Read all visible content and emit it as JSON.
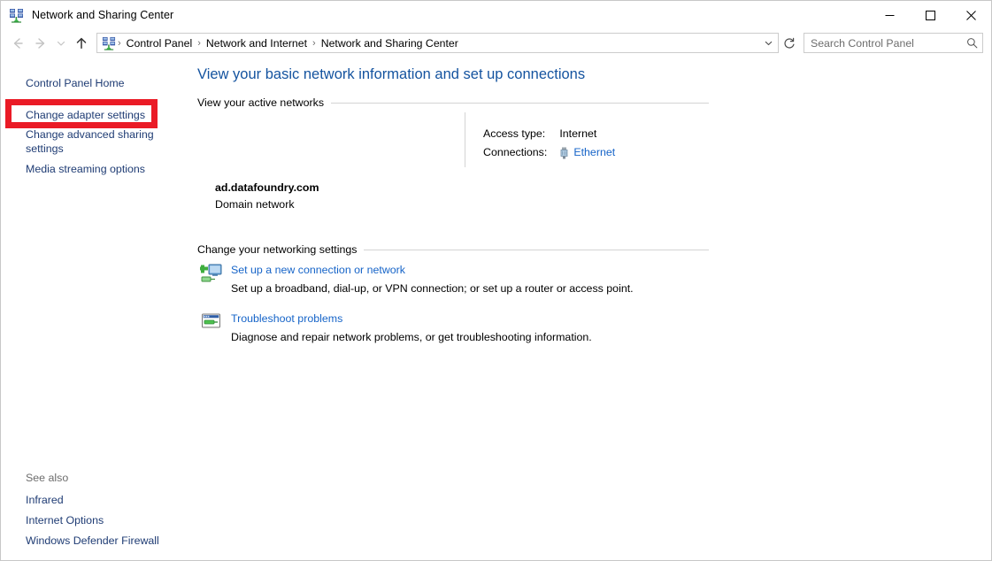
{
  "window": {
    "title": "Network and Sharing Center",
    "icon": "network-sharing-center-icon",
    "minimize_label": "Minimize",
    "maximize_label": "Maximize",
    "close_label": "Close"
  },
  "addressbar": {
    "back_label": "Back",
    "forward_label": "Forward",
    "recent_label": "Recent locations",
    "up_label": "Up one level",
    "breadcrumbs": [
      "Control Panel",
      "Network and Internet",
      "Network and Sharing Center"
    ],
    "separator": "›",
    "dropdown_label": "Previous locations",
    "refresh_label": "Refresh"
  },
  "search": {
    "placeholder": "Search Control Panel",
    "icon": "search-icon"
  },
  "sidebar": {
    "control_panel_home": "Control Panel Home",
    "items": [
      {
        "label": "Change adapter settings",
        "highlighted": true
      },
      {
        "label": "Change advanced sharing settings",
        "highlighted": false
      },
      {
        "label": "Media streaming options",
        "highlighted": false
      }
    ],
    "see_also_heading": "See also",
    "see_also": [
      "Infrared",
      "Internet Options",
      "Windows Defender Firewall"
    ]
  },
  "main": {
    "heading": "View your basic network information and set up connections",
    "active_networks_section": "View your active networks",
    "network": {
      "name": "ad.datafoundry.com",
      "type": "Domain network",
      "access_type_label": "Access type:",
      "access_type_value": "Internet",
      "connections_label": "Connections:",
      "connections_value": "Ethernet",
      "connections_icon": "ethernet-adapter-icon"
    },
    "change_settings_section": "Change your networking settings",
    "tasks": [
      {
        "icon": "new-connection-icon",
        "title": "Set up a new connection or network",
        "description": "Set up a broadband, dial-up, or VPN connection; or set up a router or access point."
      },
      {
        "icon": "troubleshoot-icon",
        "title": "Troubleshoot problems",
        "description": "Diagnose and repair network problems, or get troubleshooting information."
      }
    ]
  },
  "colors": {
    "heading_blue": "#14539f",
    "link_blue": "#1664c8",
    "sidebar_link": "#1f3c74",
    "highlight_red": "#ea1b26",
    "rule_gray": "#d4d4d4"
  }
}
